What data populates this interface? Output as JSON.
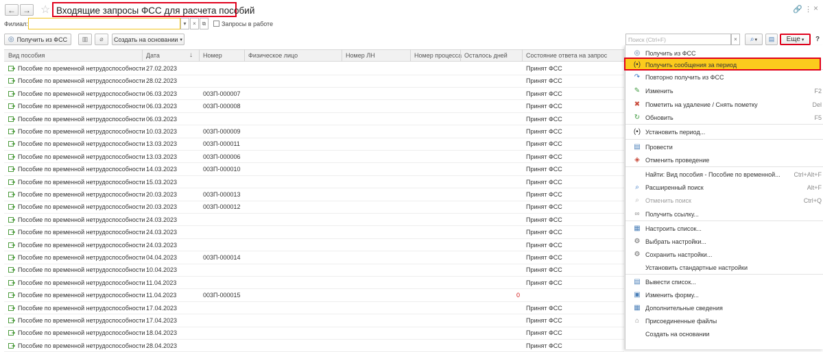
{
  "window": {
    "title": "Входящие запросы ФСС для расчета пособий",
    "back_icon": "←",
    "forward_icon": "→",
    "favorite_icon": "☆",
    "link_icon": "🔗",
    "more_icon": "⋮",
    "close_icon": "×"
  },
  "filter": {
    "filial_label": "Филиал:",
    "filial_value": "",
    "dropdown_icon": "▾",
    "clear_icon": "×",
    "open_icon": "⧉",
    "in_work_label": "Запросы в работе"
  },
  "toolbar": {
    "get_fss_label": "Получить из ФСС",
    "create_based_label": "Создать на основании",
    "search_placeholder": "Поиск (Ctrl+F)",
    "search_clear_icon": "×",
    "more_label": "Еще",
    "help_label": "?",
    "dropdown_icon": "▾"
  },
  "table": {
    "columns": [
      "Вид пособия",
      "Дата",
      "Номер",
      "Физическое лицо",
      "Номер ЛН",
      "Номер процесса",
      "Осталось дней",
      "Состояние ответа на запрос"
    ],
    "sort_icon": "↓",
    "rows": [
      {
        "type": "Пособие по временной нетрудоспособности",
        "date": "27.02.2023",
        "number": "",
        "remaining": "",
        "state": "Принят ФСС"
      },
      {
        "type": "Пособие по временной нетрудоспособности",
        "date": "28.02.2023",
        "number": "",
        "remaining": "",
        "state": "Принят ФСС"
      },
      {
        "type": "Пособие по временной нетрудоспособности",
        "date": "06.03.2023",
        "number": "003П-000007",
        "remaining": "",
        "state": "Принят ФСС"
      },
      {
        "type": "Пособие по временной нетрудоспособности",
        "date": "06.03.2023",
        "number": "003П-000008",
        "remaining": "",
        "state": "Принят ФСС"
      },
      {
        "type": "Пособие по временной нетрудоспособности",
        "date": "06.03.2023",
        "number": "",
        "remaining": "",
        "state": "Принят ФСС"
      },
      {
        "type": "Пособие по временной нетрудоспособности",
        "date": "10.03.2023",
        "number": "003П-000009",
        "remaining": "",
        "state": "Принят ФСС"
      },
      {
        "type": "Пособие по временной нетрудоспособности",
        "date": "13.03.2023",
        "number": "003П-000011",
        "remaining": "",
        "state": "Принят ФСС"
      },
      {
        "type": "Пособие по временной нетрудоспособности",
        "date": "13.03.2023",
        "number": "003П-000006",
        "remaining": "",
        "state": "Принят ФСС"
      },
      {
        "type": "Пособие по временной нетрудоспособности",
        "date": "14.03.2023",
        "number": "003П-000010",
        "remaining": "",
        "state": "Принят ФСС"
      },
      {
        "type": "Пособие по временной нетрудоспособности",
        "date": "15.03.2023",
        "number": "",
        "remaining": "",
        "state": "Принят ФСС"
      },
      {
        "type": "Пособие по временной нетрудоспособности",
        "date": "20.03.2023",
        "number": "003П-000013",
        "remaining": "",
        "state": "Принят ФСС"
      },
      {
        "type": "Пособие по временной нетрудоспособности",
        "date": "20.03.2023",
        "number": "003П-000012",
        "remaining": "",
        "state": "Принят ФСС"
      },
      {
        "type": "Пособие по временной нетрудоспособности",
        "date": "24.03.2023",
        "number": "",
        "remaining": "",
        "state": "Принят ФСС"
      },
      {
        "type": "Пособие по временной нетрудоспособности",
        "date": "24.03.2023",
        "number": "",
        "remaining": "",
        "state": "Принят ФСС"
      },
      {
        "type": "Пособие по временной нетрудоспособности",
        "date": "24.03.2023",
        "number": "",
        "remaining": "",
        "state": "Принят ФСС"
      },
      {
        "type": "Пособие по временной нетрудоспособности",
        "date": "04.04.2023",
        "number": "003П-000014",
        "remaining": "",
        "state": "Принят ФСС"
      },
      {
        "type": "Пособие по временной нетрудоспособности",
        "date": "10.04.2023",
        "number": "",
        "remaining": "",
        "state": "Принят ФСС"
      },
      {
        "type": "Пособие по временной нетрудоспособности",
        "date": "11.04.2023",
        "number": "",
        "remaining": "",
        "state": "Принят ФСС"
      },
      {
        "type": "Пособие по временной нетрудоспособности",
        "date": "11.04.2023",
        "number": "003П-000015",
        "remaining": "0",
        "state": ""
      },
      {
        "type": "Пособие по временной нетрудоспособности",
        "date": "17.04.2023",
        "number": "",
        "remaining": "",
        "state": "Принят ФСС"
      },
      {
        "type": "Пособие по временной нетрудоспособности",
        "date": "17.04.2023",
        "number": "",
        "remaining": "",
        "state": "Принят ФСС"
      },
      {
        "type": "Пособие по временной нетрудоспособности",
        "date": "18.04.2023",
        "number": "",
        "remaining": "",
        "state": "Принят ФСС"
      },
      {
        "type": "Пособие по временной нетрудоспособности",
        "date": "28.04.2023",
        "number": "",
        "remaining": "",
        "state": "Принят ФСС"
      }
    ]
  },
  "menu": {
    "items": [
      {
        "label": "Получить из ФСС",
        "shortcut": "",
        "icon": "◎",
        "icon_name": "fss-icon",
        "color": "#5a7fa8"
      },
      {
        "label": "Получить сообщения за период",
        "shortcut": "",
        "icon": "(•)",
        "icon_name": "period-icon",
        "color": "#333333"
      },
      {
        "label": "Повторно получить из ФСС",
        "shortcut": "",
        "icon": "↷",
        "icon_name": "repeat-icon",
        "color": "#2f6fc2"
      },
      {
        "label": "Изменить",
        "shortcut": "F2",
        "icon": "✎",
        "icon_name": "edit-icon",
        "color": "#3f9a3f"
      },
      {
        "label": "Пометить на удаление / Снять пометку",
        "shortcut": "Del",
        "icon": "✖",
        "icon_name": "delete-mark-icon",
        "color": "#c84a3a"
      },
      {
        "label": "Обновить",
        "shortcut": "F5",
        "icon": "↻",
        "icon_name": "refresh-icon",
        "color": "#3f9a3f"
      },
      {
        "label": "Установить период...",
        "shortcut": "",
        "icon": "(•)",
        "icon_name": "set-period-icon",
        "color": "#333333"
      },
      {
        "label": "Провести",
        "shortcut": "",
        "icon": "▤",
        "icon_name": "post-icon",
        "color": "#4a7fb8"
      },
      {
        "label": "Отменить проведение",
        "shortcut": "",
        "icon": "◈",
        "icon_name": "unpost-icon",
        "color": "#c84a3a"
      },
      {
        "label": "Найти: Вид пособия - Пособие по временной...",
        "shortcut": "Ctrl+Alt+F",
        "icon": "",
        "icon_name": "find-icon",
        "color": "#333333"
      },
      {
        "label": "Расширенный поиск",
        "shortcut": "Alt+F",
        "icon": "⌕",
        "icon_name": "advanced-search-icon",
        "color": "#2f6fc2"
      },
      {
        "label": "Отменить поиск",
        "shortcut": "Ctrl+Q",
        "icon": "⌕",
        "icon_name": "cancel-search-icon",
        "color": "#b0b0b0"
      },
      {
        "label": "Получить ссылку...",
        "shortcut": "",
        "icon": "∞",
        "icon_name": "link-icon",
        "color": "#888888"
      },
      {
        "label": "Настроить список...",
        "shortcut": "",
        "icon": "▦",
        "icon_name": "list-settings-icon",
        "color": "#4a7fb8"
      },
      {
        "label": "Выбрать настройки...",
        "shortcut": "",
        "icon": "⚙",
        "icon_name": "choose-settings-icon",
        "color": "#6a6a6a"
      },
      {
        "label": "Сохранить настройки...",
        "shortcut": "",
        "icon": "⚙",
        "icon_name": "save-settings-icon",
        "color": "#6a6a6a"
      },
      {
        "label": "Установить стандартные настройки",
        "shortcut": "",
        "icon": "",
        "icon_name": "default-settings-icon",
        "color": "#333333"
      },
      {
        "label": "Вывести список...",
        "shortcut": "",
        "icon": "▤",
        "icon_name": "output-list-icon",
        "color": "#4a7fb8"
      },
      {
        "label": "Изменить форму...",
        "shortcut": "",
        "icon": "▣",
        "icon_name": "change-form-icon",
        "color": "#4a7fb8"
      },
      {
        "label": "Дополнительные сведения",
        "shortcut": "",
        "icon": "▦",
        "icon_name": "additional-info-icon",
        "color": "#4a7fb8"
      },
      {
        "label": "Присоединенные файлы",
        "shortcut": "",
        "icon": "⌂",
        "icon_name": "attached-files-icon",
        "color": "#888888"
      },
      {
        "label": "Создать на основании",
        "shortcut": "",
        "icon": "",
        "icon_name": "create-based-icon",
        "color": "#333333"
      }
    ]
  },
  "colors": {
    "accent_yellow": "#fbcb1d",
    "highlight_red": "#e0001b",
    "row_icon_green": "#4a9a3a"
  }
}
